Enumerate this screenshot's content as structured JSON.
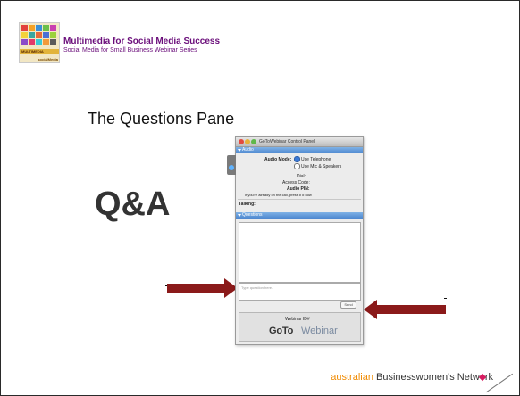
{
  "header": {
    "title": "Multimedia for Social Media Success",
    "subtitle": "Social Media for Small Business Webinar Series",
    "logo": {
      "label": "MULTIMEDIA",
      "tag": "socialMedia"
    }
  },
  "slide": {
    "title": "The Questions Pane",
    "big_label": "Q&A"
  },
  "panel": {
    "window_title": "GoToWebinar Control Panel",
    "audio_header": "Audio",
    "audio_mode_label": "Audio Mode:",
    "option_telephone": "Use Telephone",
    "option_mic": "Use Mic & Speakers",
    "selected_option": "Use Telephone",
    "dial_label": "Dial:",
    "access_code_label": "Access Code:",
    "audio_pin_label": "Audio PIN:",
    "hint": "If you're already on the call, press #  # now",
    "talking_label": "Talking:",
    "questions_header": "Questions",
    "question_placeholder": "Type question here.",
    "send_label": "Send",
    "webinar_id_label": "Webinar ID#",
    "brand_goto": "GoTo",
    "brand_webinar": "Webinar"
  },
  "footer": {
    "brand_a": "australian ",
    "brand_b": "Businesswomen's Netw",
    "brand_c": "rk"
  },
  "colors": {
    "title_purple": "#6a0d7a",
    "arrow": "#8b1a1a",
    "section_blue": "#4c86cf",
    "footer_orange": "#f08a00",
    "heart_pink": "#d81b60"
  }
}
